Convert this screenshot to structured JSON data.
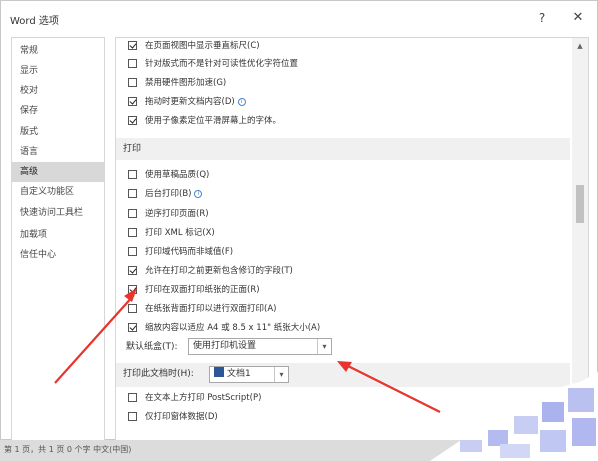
{
  "window": {
    "title": "Word 选项",
    "help_glyph": "?",
    "close_glyph": "✕"
  },
  "nav": {
    "items": [
      {
        "label": "常规"
      },
      {
        "label": "显示"
      },
      {
        "label": "校对"
      },
      {
        "label": "保存"
      },
      {
        "label": "版式"
      },
      {
        "label": "语言"
      },
      {
        "label": "高级",
        "active": true
      },
      {
        "label": "自定义功能区"
      },
      {
        "label": "快速访问工具栏"
      },
      {
        "label": "加载项"
      },
      {
        "label": "信任中心"
      }
    ]
  },
  "content": {
    "display_options": [
      {
        "label": "在页面视图中显示垂直标尺(C)",
        "checked": true
      },
      {
        "label": "针对版式而不是针对可读性优化字符位置",
        "checked": false
      },
      {
        "label": "禁用硬件图形加速(G)",
        "checked": false
      },
      {
        "label": "拖动时更新文档内容(D)",
        "checked": true,
        "info": true
      },
      {
        "label": "使用子像素定位平滑屏幕上的字体。",
        "checked": true
      }
    ],
    "print_section": {
      "title": "打印",
      "options": [
        {
          "label": "使用草稿品质(Q)",
          "checked": false
        },
        {
          "label": "后台打印(B)",
          "checked": false,
          "info": true
        },
        {
          "label": "逆序打印页面(R)",
          "checked": false
        },
        {
          "label": "打印 XML 标记(X)",
          "checked": false
        },
        {
          "label": "打印域代码而非域值(F)",
          "checked": false
        },
        {
          "label": "允许在打印之前更新包含修订的字段(T)",
          "checked": true
        },
        {
          "label": "打印在双面打印纸张的正面(R)",
          "checked": true
        },
        {
          "label": "在纸张背面打印以进行双面打印(A)",
          "checked": false
        },
        {
          "label": "缩放内容以适应 A4 或 8.5 x 11\" 纸张大小(A)",
          "checked": true
        }
      ],
      "default_tray_label": "默认纸盒(T):",
      "default_tray_value": "使用打印机设置"
    },
    "print_doc_section": {
      "label": "打印此文档时(H):",
      "doc_value": "文档1",
      "options": [
        {
          "label": "在文本上方打印 PostScript(P)",
          "checked": false
        },
        {
          "label": "仅打印窗体数据(D)",
          "checked": false
        }
      ]
    },
    "icons": {
      "checkbox": "checkbox-icon",
      "info": "info-icon",
      "dropdown": "chevron-down-icon",
      "document": "word-document-icon"
    }
  },
  "status_bar": {
    "text": "第 1 页，共 1 页    0 个字    中文(中国)"
  },
  "colors": {
    "arrow": "#e8342c",
    "active_nav": "#d8d8d8",
    "section_bg": "#f0f0f0",
    "word_blue": "#2b579a"
  }
}
